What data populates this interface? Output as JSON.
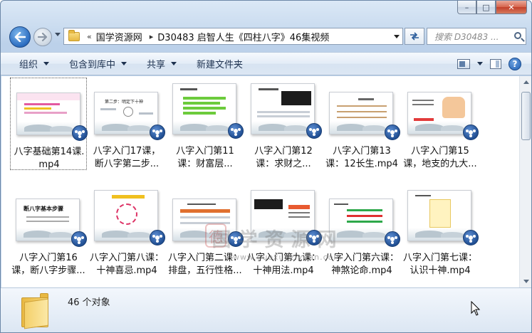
{
  "window": {
    "caption": {
      "minimize": "–",
      "maximize": "□",
      "close": "✕"
    }
  },
  "address_bar": {
    "overflow": "«",
    "crumbs": [
      "国学资源网",
      "D30483 启智人生《四柱八字》46集视频"
    ],
    "separator": "▸"
  },
  "search": {
    "placeholder": "搜索 D30483 ..."
  },
  "toolbar": {
    "organize": "组织",
    "include_in_library": "包含到库中",
    "share": "共享",
    "new_folder": "新建文件夹",
    "help": "?"
  },
  "files": [
    {
      "label_line1": "八字基础第14课.",
      "label_line2": "mp4"
    },
    {
      "label_line1": "八字入门17课，",
      "label_line2": "断八字第二步..."
    },
    {
      "label_line1": "八字入门第11",
      "label_line2": "课：财富层..."
    },
    {
      "label_line1": "八字入门第12",
      "label_line2": "课：求财之..."
    },
    {
      "label_line1": "八字入门第13",
      "label_line2": "课：12长生.mp4"
    },
    {
      "label_line1": "八字入门第15",
      "label_line2": "课，地支的九大..."
    },
    {
      "label_line1": "八字入门第16",
      "label_line2": "课，断八字步骤..."
    },
    {
      "label_line1": "八字入门第八课：",
      "label_line2": "十神喜忌.mp4"
    },
    {
      "label_line1": "八字入门第二课：",
      "label_line2": "排盘，五行性格..."
    },
    {
      "label_line1": "八字入门第九课：",
      "label_line2": "十神用法.mp4"
    },
    {
      "label_line1": "八字入门第六课：",
      "label_line2": "神煞论命.mp4"
    },
    {
      "label_line1": "八字入门第七课：",
      "label_line2": "认识十神.mp4"
    }
  ],
  "thumb_text": {
    "t2": "第二步：明定下十神",
    "t7": "断八字基本步骤"
  },
  "watermark": {
    "text": "国学资源网",
    "seal": "德",
    "url": "www.guoxueziyuan.com"
  },
  "status": {
    "count": "46 个对象"
  }
}
